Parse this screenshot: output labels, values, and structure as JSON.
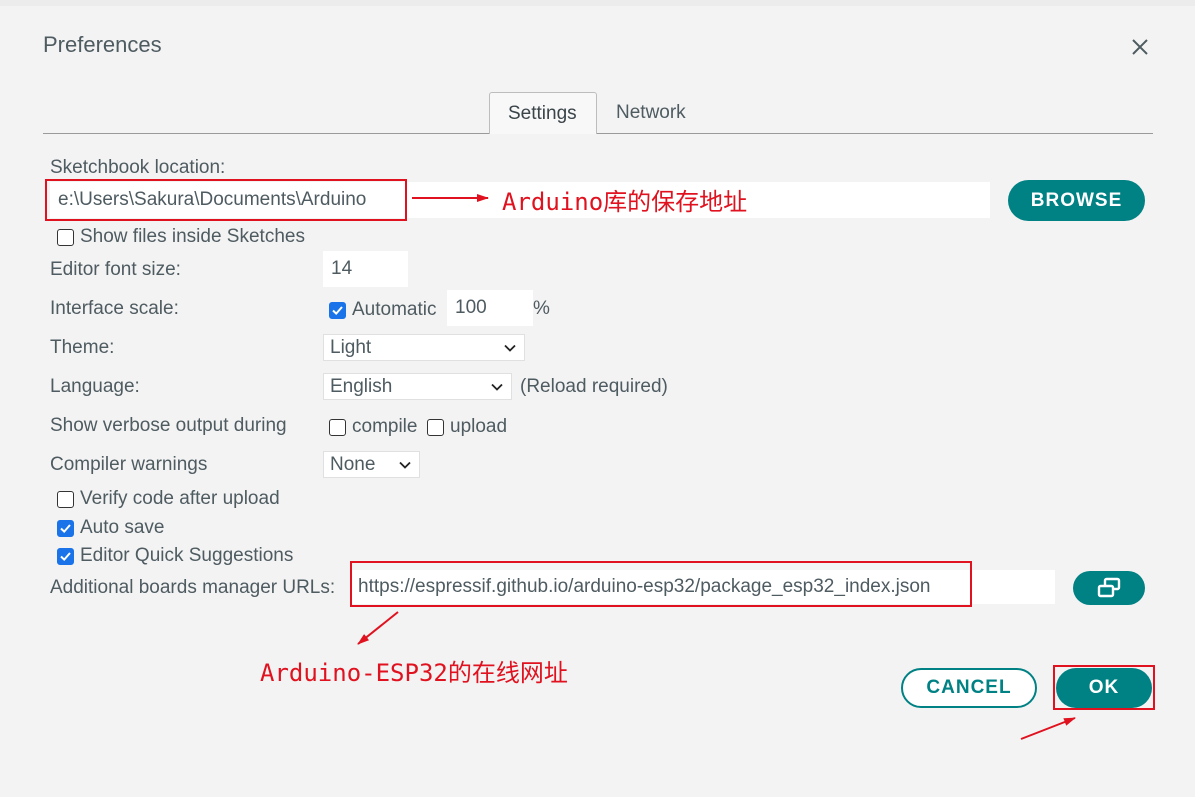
{
  "dialog": {
    "title": "Preferences",
    "close_icon": "close-icon"
  },
  "tabs": [
    {
      "label": "Settings",
      "active": true
    },
    {
      "label": "Network",
      "active": false
    }
  ],
  "settings": {
    "sketchbook_label": "Sketchbook location:",
    "sketchbook_value": "e:\\Users\\Sakura\\Documents\\Arduino",
    "browse_label": "BROWSE",
    "show_files_label": "Show files inside Sketches",
    "show_files_checked": false,
    "font_size_label": "Editor font size:",
    "font_size_value": "14",
    "scale_label": "Interface scale:",
    "scale_auto_label": "Automatic",
    "scale_auto_checked": true,
    "scale_value": "100",
    "scale_unit": "%",
    "theme_label": "Theme:",
    "theme_value": "Light",
    "language_label": "Language:",
    "language_value": "English",
    "language_note": "(Reload required)",
    "verbose_label": "Show verbose output during",
    "verbose_compile_label": "compile",
    "verbose_compile_checked": false,
    "verbose_upload_label": "upload",
    "verbose_upload_checked": false,
    "warnings_label": "Compiler warnings",
    "warnings_value": "None",
    "verify_label": "Verify code after upload",
    "verify_checked": false,
    "autosave_label": "Auto save",
    "autosave_checked": true,
    "quick_suggest_label": "Editor Quick Suggestions",
    "quick_suggest_checked": true,
    "boards_url_label": "Additional boards manager URLs:",
    "boards_url_value": "https://espressif.github.io/arduino-esp32/package_esp32_index.json"
  },
  "footer": {
    "cancel_label": "CANCEL",
    "ok_label": "OK"
  },
  "annotations": {
    "sketchbook_note": "Arduino库的保存地址",
    "boards_url_note": "Arduino-ESP32的在线网址",
    "color": "#e0121f"
  },
  "colors": {
    "accent": "#008184",
    "checkbox": "#1a73e8",
    "background": "#f3f3f3"
  }
}
